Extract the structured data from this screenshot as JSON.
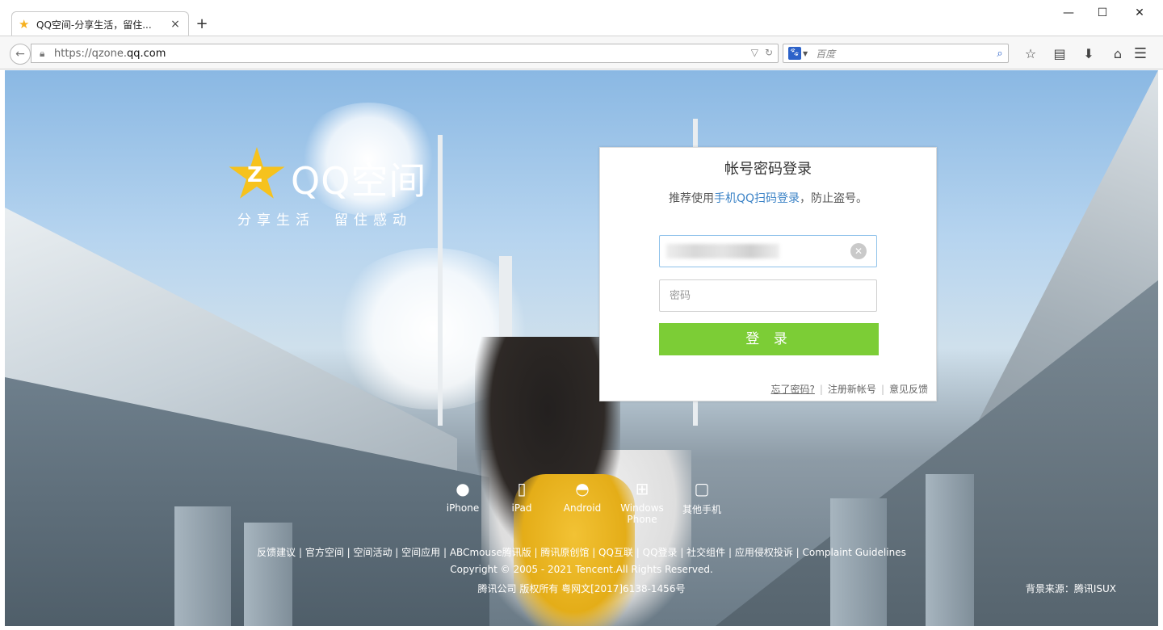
{
  "browser": {
    "tab_title": "QQ空间-分享生活，留住...",
    "tab_close": "×",
    "new_tab": "+",
    "window_controls": {
      "minimize": "—",
      "maximize": "☐",
      "close": "✕"
    },
    "url_scheme": "https://qzone.",
    "url_host": "qq.com",
    "search_placeholder": "百度",
    "search_engine_icon": "baidu-paw-icon",
    "toolbar_icons": [
      "star-bookmark-icon",
      "reading-list-icon",
      "download-icon",
      "home-icon",
      "menu-icon"
    ]
  },
  "brand": {
    "logo_text": "QQ空间",
    "slogan": "分享生活　留住感动",
    "star_color": "#f6c21d"
  },
  "login": {
    "title": "帐号密码登录",
    "tip_prefix": "推荐使用",
    "tip_link": "手机QQ扫码登录",
    "tip_suffix": "，防止盗号。",
    "account_value": "",
    "password_placeholder": "密码",
    "submit_label": "登 录",
    "forgot": "忘了密码?",
    "register": "注册新帐号",
    "feedback": "意见反馈",
    "sep": "|",
    "button_color": "#7ccd36",
    "link_color": "#3a82c6"
  },
  "devices": [
    {
      "label": "iPhone",
      "icon": "apple-icon"
    },
    {
      "label": "iPad",
      "icon": "tablet-icon"
    },
    {
      "label": "Android",
      "icon": "android-icon"
    },
    {
      "label": "Windows Phone",
      "icon": "windows-icon"
    },
    {
      "label": "其他手机",
      "icon": "phone-icon"
    }
  ],
  "footer": {
    "links": "反馈建议 | 官方空间 | 空间活动 | 空间应用 | ABCmouse腾讯版 | 腾讯原创馆 | QQ互联 | QQ登录 | 社交组件 | 应用侵权投诉 | Complaint Guidelines",
    "copyright": "Copyright © 2005 - 2021 Tencent.All Rights Reserved.",
    "license": "腾讯公司 版权所有 粤网文[2017]6138-1456号",
    "bg_source": "背景来源：腾讯ISUX"
  }
}
